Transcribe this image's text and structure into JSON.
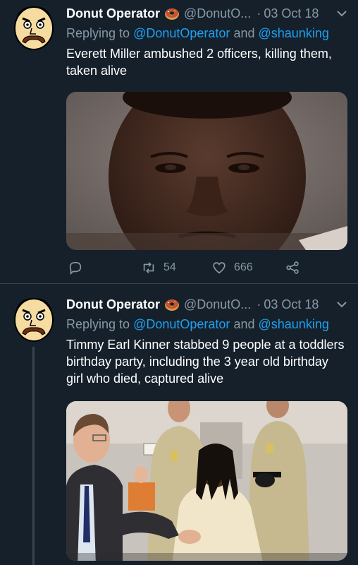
{
  "tweets": [
    {
      "author": {
        "display_name": "Donut Operator",
        "handle": "@DonutO...",
        "badge_icon": "donut-icon"
      },
      "separator": "·",
      "date": "03 Oct 18",
      "reply": {
        "prefix": "Replying to",
        "mention1": "@DonutOperator",
        "conjunction": "and",
        "mention2": "@shaunking"
      },
      "text": "Everett Miller ambushed 2 officers, killing them, taken alive",
      "actions": {
        "reply_count": "",
        "retweet_count": "54",
        "like_count": "666"
      }
    },
    {
      "author": {
        "display_name": "Donut Operator",
        "handle": "@DonutO...",
        "badge_icon": "donut-icon"
      },
      "separator": "·",
      "date": "03 Oct 18",
      "reply": {
        "prefix": "Replying to",
        "mention1": "@DonutOperator",
        "conjunction": "and",
        "mention2": "@shaunking"
      },
      "text": "Timmy Earl Kinner stabbed 9 people at a toddlers birthday party, including the 3 year old birthday girl who died, captured alive"
    }
  ],
  "colors": {
    "background": "#15202b",
    "secondary_text": "#8899a6",
    "link": "#1da1f2",
    "divider": "#38444d"
  }
}
